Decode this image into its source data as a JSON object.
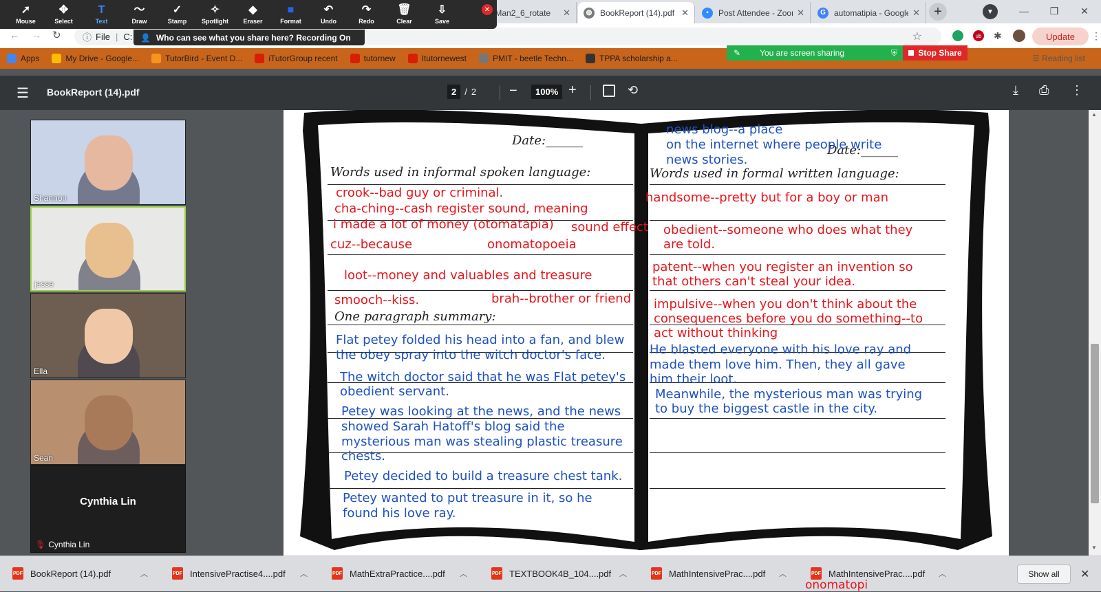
{
  "zoom_toolbar": {
    "tools": [
      {
        "label": "Mouse",
        "icon": "cursor-icon"
      },
      {
        "label": "Select",
        "icon": "move-icon"
      },
      {
        "label": "Text",
        "icon": "text-icon"
      },
      {
        "label": "Draw",
        "icon": "draw-icon"
      },
      {
        "label": "Stamp",
        "icon": "stamp-icon"
      },
      {
        "label": "Spotlight",
        "icon": "spotlight-icon"
      },
      {
        "label": "Eraser",
        "icon": "eraser-icon"
      },
      {
        "label": "Format",
        "icon": "format-icon"
      },
      {
        "label": "Undo",
        "icon": "undo-icon"
      },
      {
        "label": "Redo",
        "icon": "redo-icon"
      },
      {
        "label": "Clear",
        "icon": "trash-icon"
      },
      {
        "label": "Save",
        "icon": "save-icon"
      }
    ],
    "who_can_see": "Who can see what you share here? Recording On",
    "sharing_text": "You are screen sharing",
    "stop_share": "Stop Share"
  },
  "tabs": [
    {
      "label": "ogMan2_6_rotate",
      "fav_color": "#e94235"
    },
    {
      "label": "BookReport (14).pdf",
      "fav_color": "#7a7a7a"
    },
    {
      "label": "Post Attendee - Zoom",
      "fav_color": "#2d8cff"
    },
    {
      "label": "automatipia - Google",
      "fav_color": "#4285f4"
    }
  ],
  "address": {
    "file_label": "File",
    "url": "C:"
  },
  "update_label": "Update",
  "bookmarks": [
    {
      "label": "Apps",
      "color": "#4285f4"
    },
    {
      "label": "My Drive - Google...",
      "color": "#fbbc04"
    },
    {
      "label": "TutorBird - Event D...",
      "color": "#f7941d"
    },
    {
      "label": "iTutorGroup recent",
      "color": "#d81e05"
    },
    {
      "label": "tutornew",
      "color": "#d81e05"
    },
    {
      "label": "Itutornewest",
      "color": "#d81e05"
    },
    {
      "label": "PMIT - beetle Techn...",
      "color": "#777777"
    },
    {
      "label": "TPPA scholarship a...",
      "color": "#333333"
    }
  ],
  "reading_list": "Reading list",
  "pdf": {
    "title": "BookReport (14).pdf",
    "page_current": "2",
    "page_sep": "/",
    "page_total": "2",
    "zoom": "100%"
  },
  "participants": [
    {
      "name": "Shannon",
      "bg": "#c9d4e8",
      "skin": "#e6b8a0"
    },
    {
      "name": "jesse",
      "bg": "#e8e8e6",
      "skin": "#e8c090"
    },
    {
      "name": "Ella",
      "bg": "#6e5e52",
      "skin": "#f0c8a8"
    },
    {
      "name": "Sean",
      "bg": "#b89070",
      "skin": "#a97a5a"
    }
  ],
  "muted_participant": {
    "display": "Cynthia Lin",
    "label": "Cynthia Lin"
  },
  "worksheet": {
    "date_label": "Date:______",
    "left_heading": "Words used in informal spoken language:",
    "right_heading": "Words used in formal written language:",
    "summary_heading": "One paragraph summary:",
    "left_red": [
      "crook--bad guy or criminal.",
      "cha-ching--cash register sound, meaning",
      "i made a lot of money (otomatapia)",
      "sound effect",
      "cuz--because",
      "onomatopoeia",
      "loot--money and valuables and treasure",
      "smooch--kiss.",
      "brah--brother or friend"
    ],
    "right_red": [
      "handsome--pretty but for a boy or man",
      "obedient--someone who does what they",
      "are told.",
      "patent--when you register an invention so",
      "that others can't steal your idea.",
      "impulsive--when you don't think about the",
      "consequences before you do something--to",
      "act without thinking"
    ],
    "right_blue_top": [
      "news blog--a place",
      "on the internet where people write",
      "news stories."
    ],
    "left_blue": [
      "Flat petey folded his head into a fan, and blew",
      "the obey spray into the witch doctor's face.",
      "The witch doctor said that he was Flat petey's",
      "obedient servant.",
      "Petey was looking at the news, and the news",
      "showed Sarah Hatoff's blog said the",
      "mysterious man was stealing plastic treasure",
      "chests.",
      "Petey decided to build a treasure chest tank.",
      "Petey wanted to put treasure in it, so he",
      "found his love ray."
    ],
    "right_blue": [
      "He blasted everyone with his love ray and",
      "made them love him. Then, they all gave",
      "him their loot.",
      "Meanwhile, the mysterious man was trying",
      "to buy the biggest castle in the city."
    ]
  },
  "downloads": [
    "BookReport (14).pdf",
    "IntensivePractise4....pdf",
    "MathExtraPractice....pdf",
    "TEXTBOOK4B_104....pdf",
    "MathIntensivePrac....pdf",
    "MathIntensivePrac....pdf"
  ],
  "download_overlay_text": "onomatopi",
  "show_all": "Show all"
}
